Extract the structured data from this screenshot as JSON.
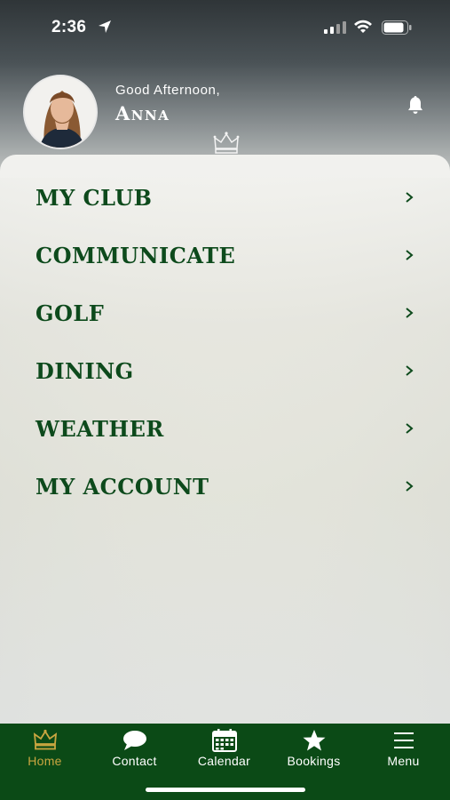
{
  "status_bar": {
    "time": "2:36"
  },
  "profile": {
    "greeting": "Good Afternoon,",
    "name": "Anna"
  },
  "menu": {
    "items": [
      {
        "label": "MY CLUB"
      },
      {
        "label": "COMMUNICATE"
      },
      {
        "label": "GOLF"
      },
      {
        "label": "DINING"
      },
      {
        "label": "WEATHER"
      },
      {
        "label": "MY ACCOUNT"
      }
    ]
  },
  "tab_bar": {
    "tabs": [
      {
        "label": "Home",
        "icon": "crown-icon",
        "active": true
      },
      {
        "label": "Contact",
        "icon": "chat-bubble-icon",
        "active": false
      },
      {
        "label": "Calendar",
        "icon": "calendar-icon",
        "active": false
      },
      {
        "label": "Bookings",
        "icon": "star-icon",
        "active": false
      },
      {
        "label": "Menu",
        "icon": "hamburger-icon",
        "active": false
      }
    ]
  },
  "colors": {
    "brand_green": "#0b4a16",
    "menu_text": "#0d4a1c",
    "active_tab": "#c9a640"
  }
}
